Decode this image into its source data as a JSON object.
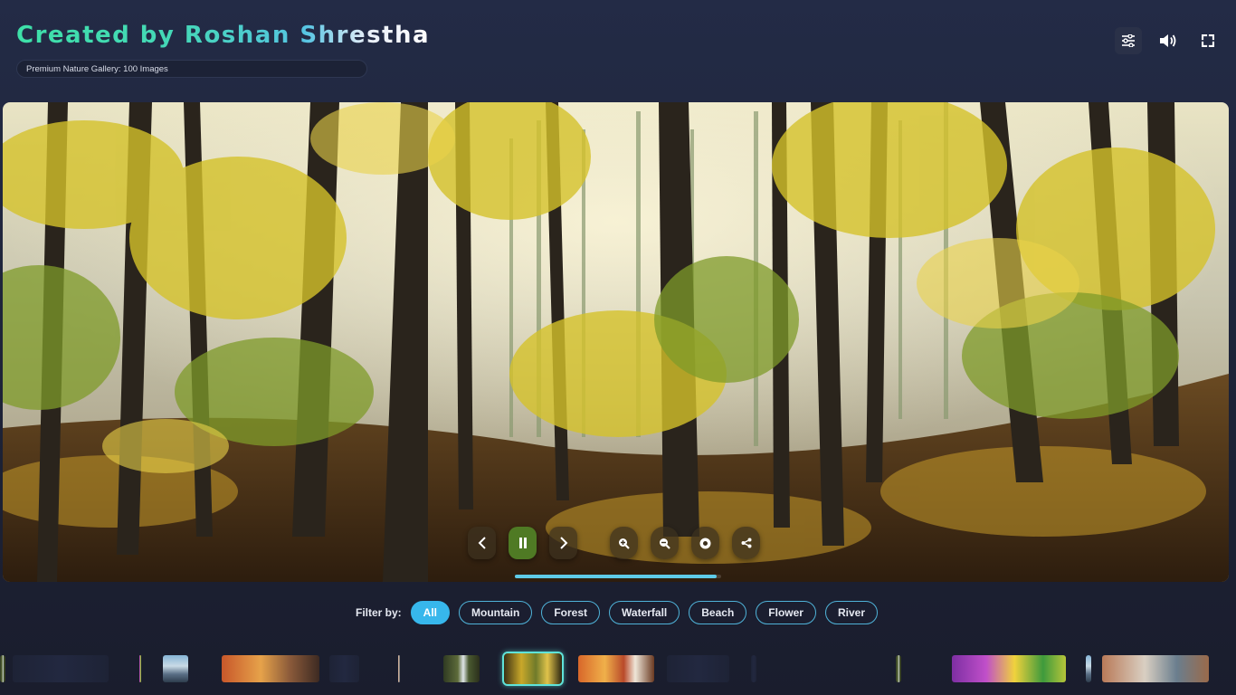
{
  "header": {
    "title": "Created by Roshan Shrestha",
    "subtitle": "Premium Nature Gallery: 100 Images"
  },
  "toolbar": {
    "items": [
      {
        "icon": "sliders-icon",
        "label": "settings"
      },
      {
        "icon": "volume-icon",
        "label": "sound"
      },
      {
        "icon": "fullscreen-icon",
        "label": "fullscreen"
      }
    ]
  },
  "viewer": {
    "current_category": "Forest",
    "slideshow_state": "playing",
    "progress_fraction": 0.98,
    "controls": [
      "chevron-left-icon",
      "pause-icon",
      "chevron-right-icon",
      "zoom-in-icon",
      "zoom-out-icon",
      "reset-icon",
      "share-icon"
    ]
  },
  "filters": {
    "label": "Filter by:",
    "options": [
      "All",
      "Mountain",
      "Forest",
      "Waterfall",
      "Beach",
      "Flower",
      "River"
    ],
    "selected": "All"
  },
  "colors": {
    "accent": "#37b7ec",
    "play_button": "#4f7a24",
    "current_thumb_border": "#5fe3d9",
    "background": "#1d2236"
  },
  "thumbnails": {
    "themes": [
      "waterfall",
      "blank",
      "flower",
      "mountain",
      "autumn",
      "blank",
      "river",
      "waterfall",
      "forest",
      "sunset-waterfall",
      "blank",
      "blank",
      "flower",
      "mountain",
      "river",
      "waterfall"
    ],
    "current_index": 8
  }
}
